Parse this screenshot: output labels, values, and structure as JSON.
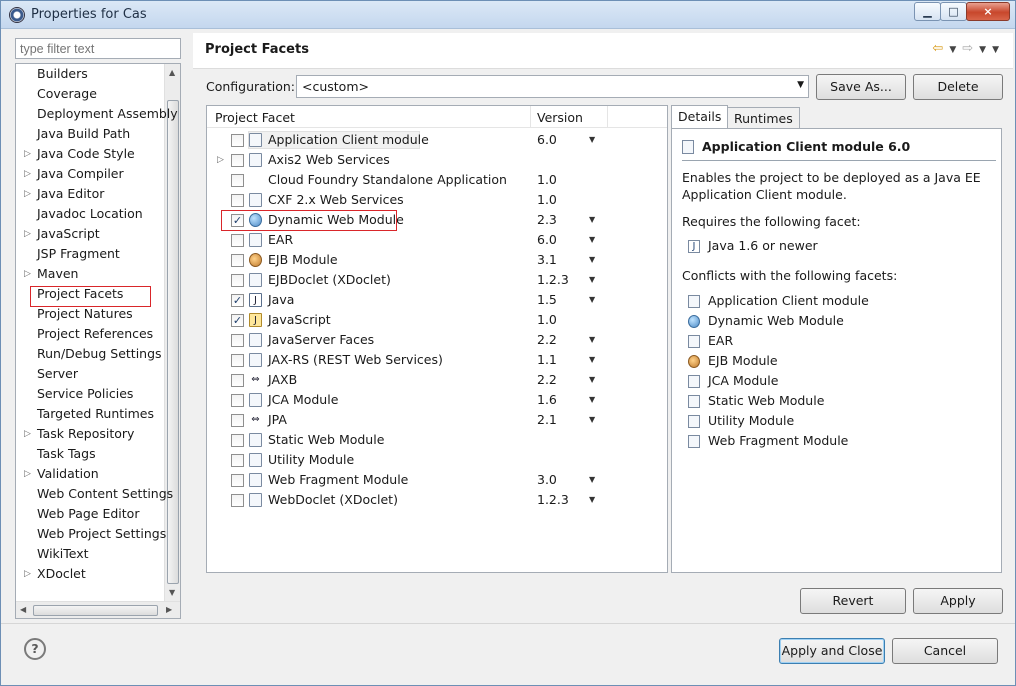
{
  "window": {
    "title": "Properties for Cas",
    "minimize": "0",
    "maximize": "□",
    "close": "×"
  },
  "filter": {
    "placeholder": "type filter text"
  },
  "tree": {
    "items": [
      {
        "label": "Builders",
        "expandable": false
      },
      {
        "label": "Coverage",
        "expandable": false
      },
      {
        "label": "Deployment Assembly",
        "expandable": false
      },
      {
        "label": "Java Build Path",
        "expandable": false
      },
      {
        "label": "Java Code Style",
        "expandable": true
      },
      {
        "label": "Java Compiler",
        "expandable": true
      },
      {
        "label": "Java Editor",
        "expandable": true
      },
      {
        "label": "Javadoc Location",
        "expandable": false
      },
      {
        "label": "JavaScript",
        "expandable": true
      },
      {
        "label": "JSP Fragment",
        "expandable": false
      },
      {
        "label": "Maven",
        "expandable": true
      },
      {
        "label": "Project Facets",
        "expandable": false,
        "selected": true
      },
      {
        "label": "Project Natures",
        "expandable": false
      },
      {
        "label": "Project References",
        "expandable": false
      },
      {
        "label": "Run/Debug Settings",
        "expandable": false
      },
      {
        "label": "Server",
        "expandable": false
      },
      {
        "label": "Service Policies",
        "expandable": false
      },
      {
        "label": "Targeted Runtimes",
        "expandable": false
      },
      {
        "label": "Task Repository",
        "expandable": true
      },
      {
        "label": "Task Tags",
        "expandable": false
      },
      {
        "label": "Validation",
        "expandable": true
      },
      {
        "label": "Web Content Settings",
        "expandable": false
      },
      {
        "label": "Web Page Editor",
        "expandable": false
      },
      {
        "label": "Web Project Settings",
        "expandable": false
      },
      {
        "label": "WikiText",
        "expandable": false
      },
      {
        "label": "XDoclet",
        "expandable": true
      }
    ]
  },
  "page": {
    "title": "Project Facets",
    "back_icon": "⇦",
    "forward_icon": "⇨",
    "menu_icon": "▼"
  },
  "configuration": {
    "label": "Configuration:",
    "value": "<custom>",
    "save_as": "Save As...",
    "delete": "Delete"
  },
  "facets": {
    "col_facet": "Project Facet",
    "col_version": "Version",
    "rows": [
      {
        "name": "Application Client module",
        "version": "6.0",
        "dropdown": true,
        "checked": false,
        "icon": "file-icon",
        "expander": false
      },
      {
        "name": "Axis2 Web Services",
        "version": "",
        "dropdown": false,
        "checked": false,
        "icon": "file-icon",
        "expander": true
      },
      {
        "name": "Cloud Foundry Standalone Application",
        "version": "1.0",
        "dropdown": false,
        "checked": false,
        "icon": "none",
        "expander": false
      },
      {
        "name": "CXF 2.x Web Services",
        "version": "1.0",
        "dropdown": false,
        "checked": false,
        "icon": "file-icon",
        "expander": false
      },
      {
        "name": "Dynamic Web Module",
        "version": "2.3",
        "dropdown": true,
        "checked": true,
        "icon": "web-icon",
        "expander": false
      },
      {
        "name": "EAR",
        "version": "6.0",
        "dropdown": true,
        "checked": false,
        "icon": "file-icon",
        "expander": false
      },
      {
        "name": "EJB Module",
        "version": "3.1",
        "dropdown": true,
        "checked": false,
        "icon": "ejb-icon",
        "expander": false
      },
      {
        "name": "EJBDoclet (XDoclet)",
        "version": "1.2.3",
        "dropdown": true,
        "checked": false,
        "icon": "file-icon",
        "expander": false
      },
      {
        "name": "Java",
        "version": "1.5",
        "dropdown": true,
        "checked": true,
        "icon": "java-icon",
        "expander": false
      },
      {
        "name": "JavaScript",
        "version": "1.0",
        "dropdown": false,
        "checked": true,
        "icon": "js-icon",
        "expander": false
      },
      {
        "name": "JavaServer Faces",
        "version": "2.2",
        "dropdown": true,
        "checked": false,
        "icon": "file-icon",
        "expander": false
      },
      {
        "name": "JAX-RS (REST Web Services)",
        "version": "1.1",
        "dropdown": true,
        "checked": false,
        "icon": "file-icon",
        "expander": false
      },
      {
        "name": "JAXB",
        "version": "2.2",
        "dropdown": true,
        "checked": false,
        "icon": "jaxb-icon",
        "expander": false
      },
      {
        "name": "JCA Module",
        "version": "1.6",
        "dropdown": true,
        "checked": false,
        "icon": "file-icon",
        "expander": false
      },
      {
        "name": "JPA",
        "version": "2.1",
        "dropdown": true,
        "checked": false,
        "icon": "jaxb-icon",
        "expander": false
      },
      {
        "name": "Static Web Module",
        "version": "",
        "dropdown": false,
        "checked": false,
        "icon": "file-icon",
        "expander": false
      },
      {
        "name": "Utility Module",
        "version": "",
        "dropdown": false,
        "checked": false,
        "icon": "file-icon",
        "expander": false
      },
      {
        "name": "Web Fragment Module",
        "version": "3.0",
        "dropdown": true,
        "checked": false,
        "icon": "file-icon",
        "expander": false
      },
      {
        "name": "WebDoclet (XDoclet)",
        "version": "1.2.3",
        "dropdown": true,
        "checked": false,
        "icon": "file-icon",
        "expander": false
      }
    ]
  },
  "details": {
    "tab_details": "Details",
    "tab_runtimes": "Runtimes",
    "title": "Application Client module 6.0",
    "description_line1": "Enables the project to be deployed as a Java EE",
    "description_line2": "Application Client module.",
    "requires_label": "Requires the following facet:",
    "requires": [
      {
        "label": "Java 1.6 or newer",
        "icon": "java-icon"
      }
    ],
    "conflicts_label": "Conflicts with the following facets:",
    "conflicts": [
      {
        "label": "Application Client module",
        "icon": "file-icon"
      },
      {
        "label": "Dynamic Web Module",
        "icon": "web-icon"
      },
      {
        "label": "EAR",
        "icon": "file-icon"
      },
      {
        "label": "EJB Module",
        "icon": "ejb-icon"
      },
      {
        "label": "JCA Module",
        "icon": "file-icon"
      },
      {
        "label": "Static Web Module",
        "icon": "file-icon"
      },
      {
        "label": "Utility Module",
        "icon": "file-icon"
      },
      {
        "label": "Web Fragment Module",
        "icon": "file-icon"
      }
    ]
  },
  "buttons": {
    "revert": "Revert",
    "apply": "Apply",
    "apply_and_close": "Apply and Close",
    "cancel": "Cancel",
    "help": "?"
  }
}
